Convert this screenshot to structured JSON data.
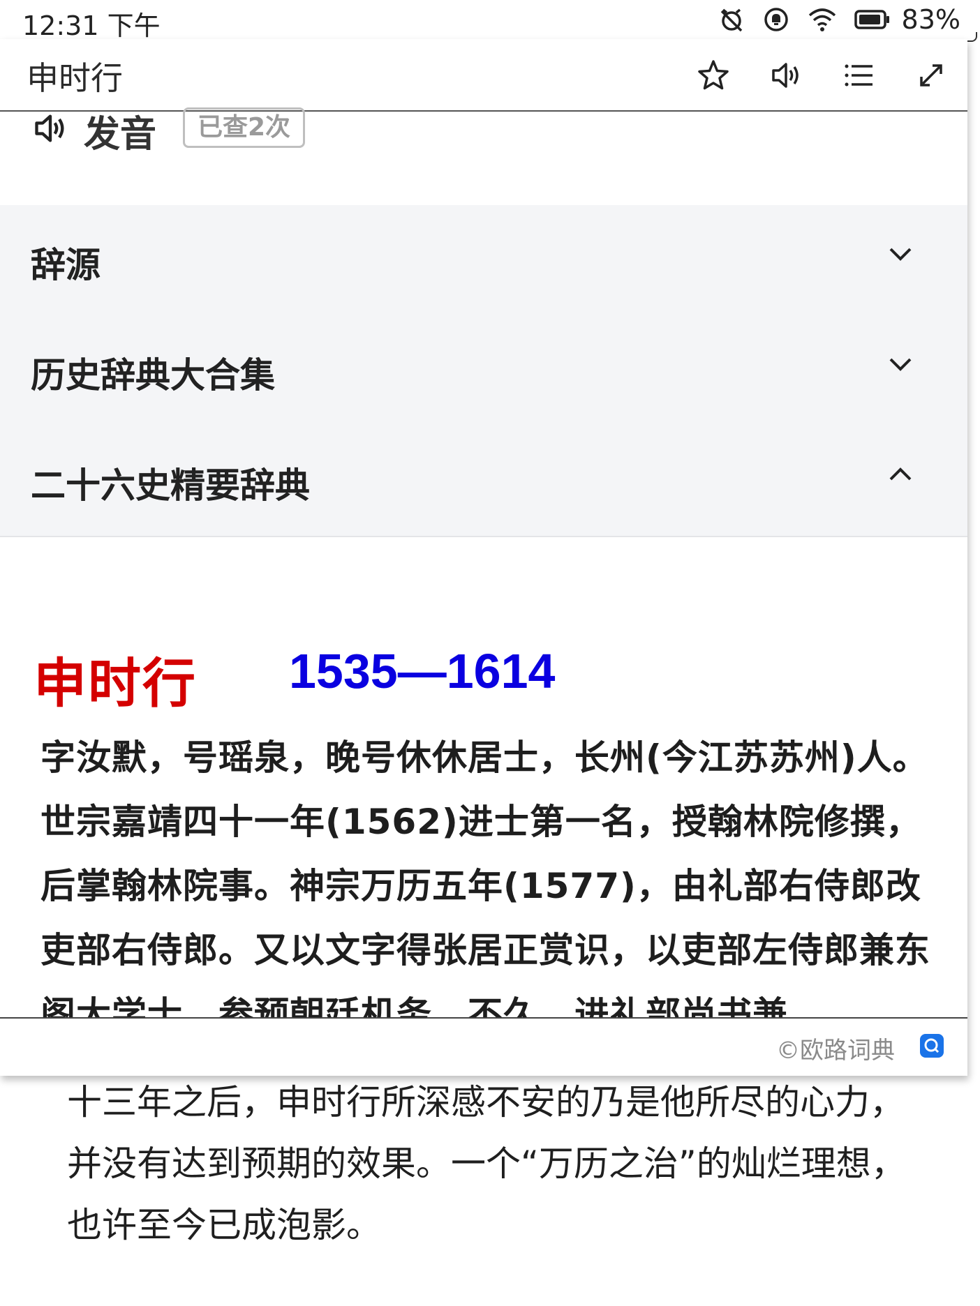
{
  "status_bar": {
    "time": "12:31 下午",
    "battery": "83%",
    "icons": [
      "alarm-off-icon",
      "notification-icon",
      "wifi-icon",
      "battery-icon"
    ]
  },
  "popup": {
    "title": "申时行",
    "tools": [
      "star-icon",
      "speaker-icon",
      "list-icon",
      "expand-icon"
    ],
    "pronunciation_label": "发音",
    "lookup_count": "已查2次",
    "sections": [
      {
        "label": "辞源",
        "expanded": false
      },
      {
        "label": "历史辞典大合集",
        "expanded": false
      },
      {
        "label": "二十六史精要辞典",
        "expanded": true
      }
    ],
    "entry": {
      "name": "申时行",
      "years": "1535—1614",
      "body": "字汝默，号瑶泉，晚号休休居士，长州(今江苏苏州)人。世宗嘉靖四十一年(1562)进士第一名，授翰林院修撰，后掌翰林院事。神宗万历五年(1577)，由礼部右侍郎改吏部右侍郎。又以文字得张居正赏识，以吏部左侍郎兼东阁大学士，参预朝廷机务。不久，进礼部尚书兼"
    },
    "copyright": "©欧路词典"
  },
  "article": {
    "text": "十三年之后，申时行所深感不安的乃是他所尽的心力，并没有达到预期的效果。一个“万历之治”的灿烂理想，也许至今已成泡影。"
  },
  "colors": {
    "name_red": "#d40000",
    "years_blue": "#0a00e0",
    "section_bg": "#f4f5f7"
  }
}
